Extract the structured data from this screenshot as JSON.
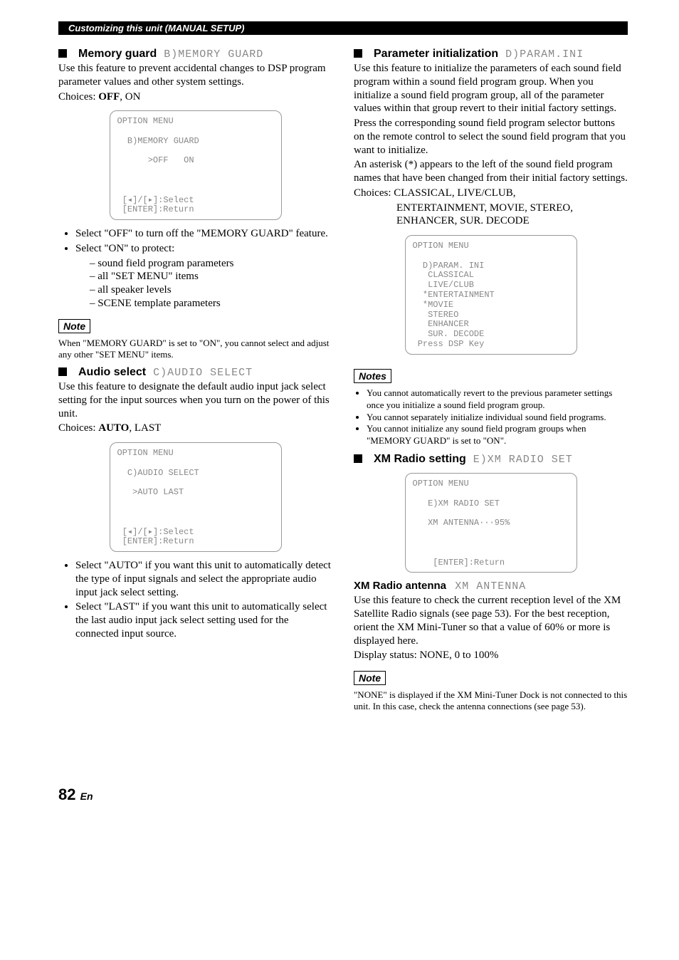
{
  "header_bar": "Customizing this unit (MANUAL SETUP)",
  "left": {
    "memory_guard": {
      "title": "Memory guard",
      "code": "B)MEMORY GUARD",
      "paras": [
        "Use this feature to prevent accidental changes to DSP program parameter values and other system settings.",
        "Choices: OFF, ON"
      ],
      "lcd": "OPTION MENU\n\n  B)MEMORY GUARD\n\n      >OFF   ON\n\n\n\n [◂]/[▸]:Select\n [ENTER]:Return",
      "bullets": [
        "Select \"OFF\" to turn off the \"MEMORY GUARD\" feature.",
        "Select \"ON\" to protect:"
      ],
      "dashes": [
        "sound field program parameters",
        "all \"SET MENU\" items",
        "all speaker levels",
        "SCENE template parameters"
      ],
      "note_label": "Note",
      "note_text": "When \"MEMORY GUARD\" is set to \"ON\", you cannot select and adjust any other \"SET MENU\" items."
    },
    "audio_select": {
      "title": "Audio select",
      "code": "C)AUDIO SELECT",
      "paras": [
        "Use this feature to designate the default audio input jack select setting for the input sources when you turn on the power of this unit.",
        "Choices: AUTO, LAST"
      ],
      "lcd": "OPTION MENU\n\n  C)AUDIO SELECT\n\n   >AUTO LAST\n\n\n\n [◂]/[▸]:Select\n [ENTER]:Return",
      "bullets": [
        "Select \"AUTO\" if you want this unit to automatically detect the type of input signals and select the appropriate audio input jack select setting.",
        "Select \"LAST\" if you want this unit to automatically select the last audio input jack select setting used for the connected input source."
      ]
    }
  },
  "right": {
    "param_ini": {
      "title": "Parameter initialization",
      "code": "D)PARAM.INI",
      "para1": "Use this feature to initialize the parameters of each sound field program within a sound field program group. When you initialize a sound field program group, all of the parameter values within that group revert to their initial factory settings.",
      "para2": "Press the corresponding sound field program selector buttons on the remote control to select the sound field program that you want to initialize.",
      "para3": "An asterisk (*) appears to the left of the sound field program names that have been changed from their initial factory settings.",
      "choices1": "Choices: CLASSICAL, LIVE/CLUB,",
      "choices2": "ENTERTAINMENT, MOVIE, STEREO, ENHANCER, SUR. DECODE",
      "lcd": "OPTION MENU\n\n  D)PARAM. INI\n   CLASSICAL\n   LIVE/CLUB\n  *ENTERTAINMENT\n  *MOVIE\n   STEREO\n   ENHANCER\n   SUR. DECODE\n Press DSP Key",
      "notes_label": "Notes",
      "notes": [
        "You cannot automatically revert to the previous parameter settings once you initialize a sound field program group.",
        "You cannot separately initialize individual sound field programs.",
        "You cannot initialize any sound field program groups when \"MEMORY GUARD\" is set to \"ON\"."
      ]
    },
    "xm_radio": {
      "title": "XM Radio setting",
      "code": "E)XM RADIO SET",
      "lcd": "OPTION MENU\n\n   E)XM RADIO SET\n\n   XM ANTENNA···95%\n\n\n\n    [ENTER]:Return",
      "sub_title": "XM Radio antenna",
      "sub_code": "XM ANTENNA",
      "para1": "Use this feature to check the current reception level of the XM Satellite Radio signals (see page 53). For the best reception, orient the XM Mini-Tuner so that a value of 60% or more is displayed here.",
      "para2": "Display status: NONE, 0 to 100%",
      "note_label": "Note",
      "note_text": "\"NONE\" is displayed if the XM Mini-Tuner Dock is not connected to this unit. In this case, check the antenna connections (see page 53)."
    }
  },
  "page_number": "82",
  "page_lang": "En"
}
